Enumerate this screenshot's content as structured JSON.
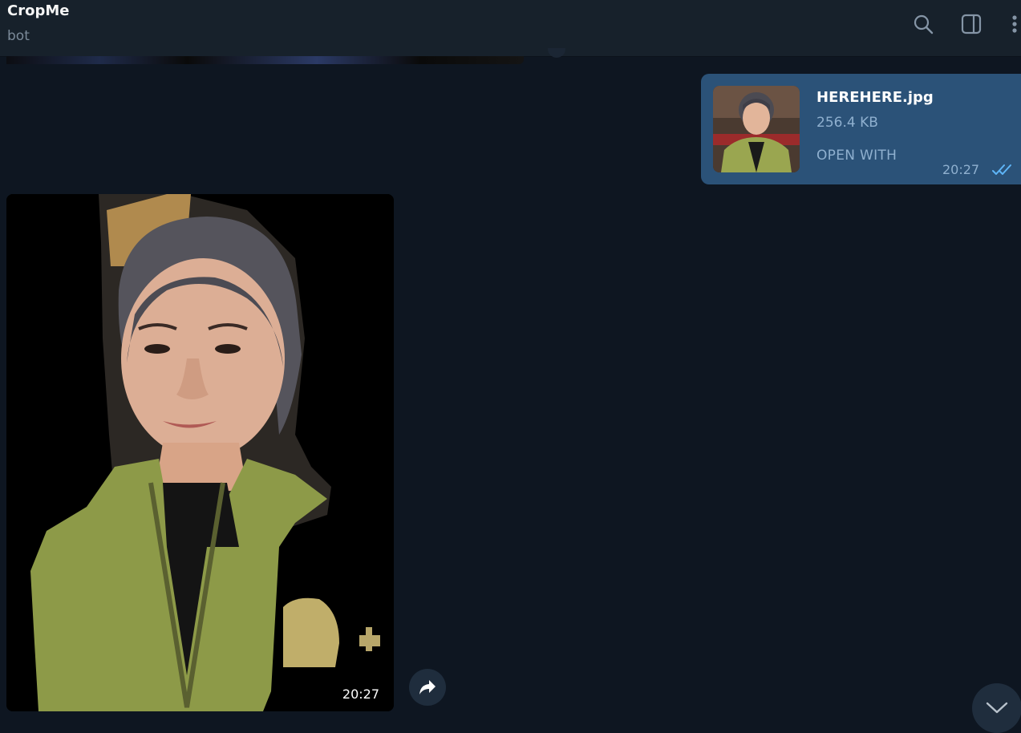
{
  "header": {
    "title": "CropMe",
    "subtitle": "bot",
    "icons": [
      "search-icon",
      "sidebar-toggle-icon",
      "more-vertical-icon"
    ]
  },
  "messages": {
    "file": {
      "name": "HEREHERE.jpg",
      "size": "256.4 KB",
      "action": "OPEN WITH",
      "time": "20:27",
      "status": "read"
    },
    "photo": {
      "time": "20:27"
    }
  },
  "colors": {
    "background": "#0e1621",
    "header": "#17212b",
    "outgoing_bubble": "#2b5278",
    "accent": "#5eb5f7"
  }
}
